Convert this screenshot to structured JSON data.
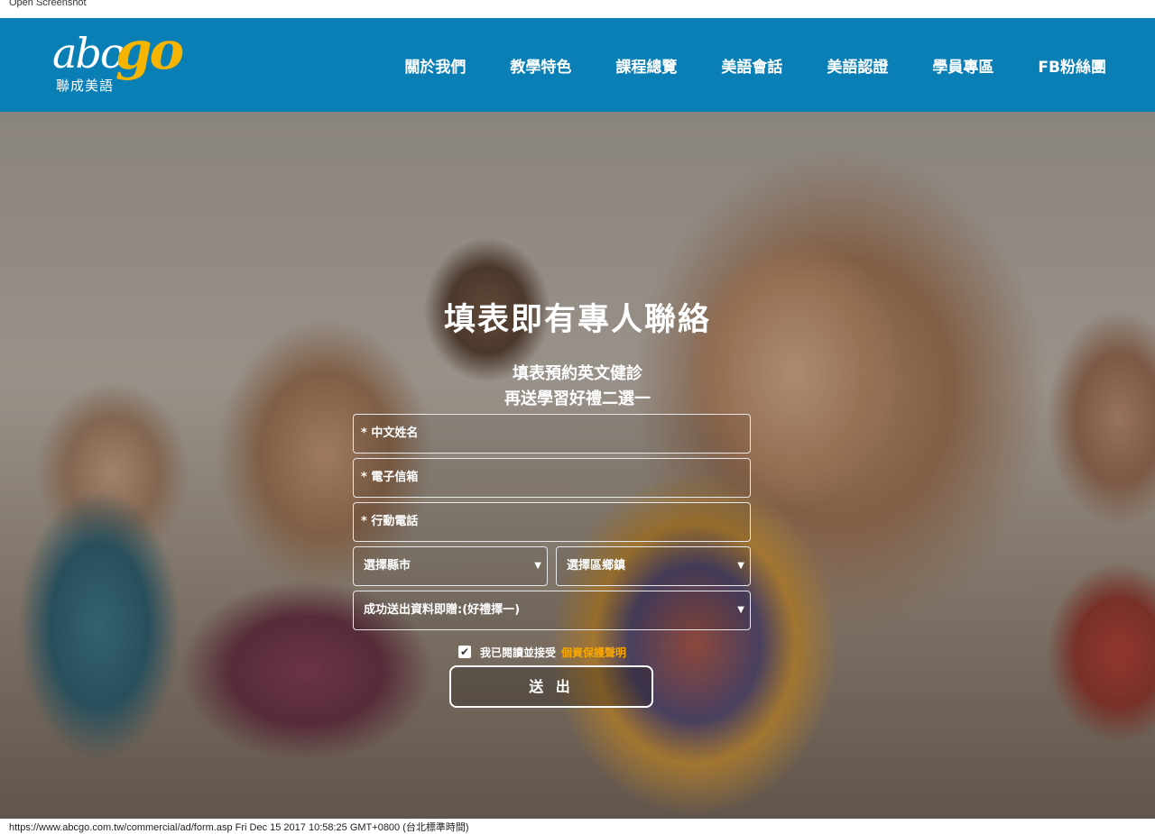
{
  "window": {
    "caption": "Open Screenshot"
  },
  "header": {
    "logo": {
      "abc": "abc",
      "go": "go",
      "sub": "聯成美語"
    },
    "nav": [
      "關於我們",
      "教學特色",
      "課程總覽",
      "美語會話",
      "美語認證",
      "學員專區",
      "FB粉絲團"
    ]
  },
  "hero": {
    "title": "填表即有專人聯絡",
    "subtitle_line1": "填表預約英文健診",
    "subtitle_line2": "再送學習好禮二選一"
  },
  "form": {
    "name_placeholder": "* 中文姓名",
    "email_placeholder": "* 電子信箱",
    "phone_placeholder": "* 行動電話",
    "city_select": "選擇縣市",
    "district_select": "選擇區鄉鎮",
    "gift_select": "成功送出資料即贈:(好禮擇一)",
    "agree_checked": true,
    "agree_text": "我已閱讀並接受",
    "privacy_link": "個資保護聲明",
    "submit_label": "送 出"
  },
  "footer": {
    "url_line": "https://www.abcgo.com.tw/commercial/ad/form.asp Fri Dec 15 2017 10:58:25 GMT+0800 (台北標準時間)"
  },
  "colors": {
    "header_bg": "#0a7fb5",
    "logo_go": "#f4b400",
    "privacy_link": "#f7a700"
  }
}
